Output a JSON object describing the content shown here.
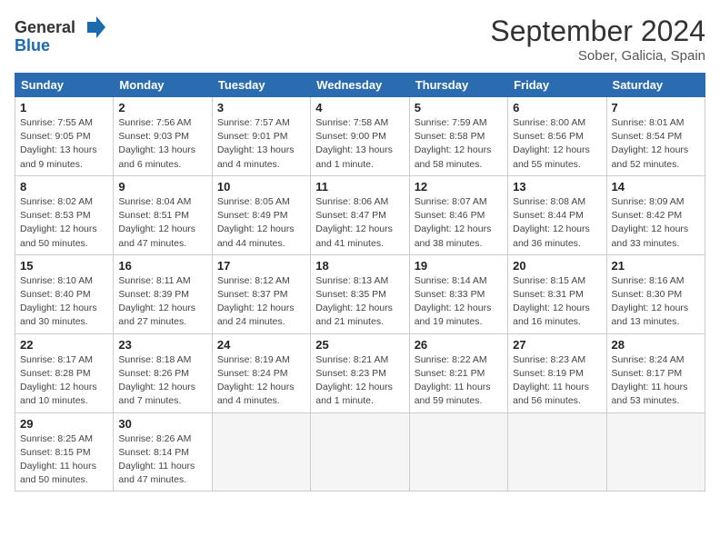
{
  "header": {
    "logo_general": "General",
    "logo_blue": "Blue",
    "month_title": "September 2024",
    "subtitle": "Sober, Galicia, Spain"
  },
  "days_of_week": [
    "Sunday",
    "Monday",
    "Tuesday",
    "Wednesday",
    "Thursday",
    "Friday",
    "Saturday"
  ],
  "weeks": [
    [
      {
        "day": "1",
        "sunrise": "7:55 AM",
        "sunset": "9:05 PM",
        "daylight": "13 hours and 9 minutes."
      },
      {
        "day": "2",
        "sunrise": "7:56 AM",
        "sunset": "9:03 PM",
        "daylight": "13 hours and 6 minutes."
      },
      {
        "day": "3",
        "sunrise": "7:57 AM",
        "sunset": "9:01 PM",
        "daylight": "13 hours and 4 minutes."
      },
      {
        "day": "4",
        "sunrise": "7:58 AM",
        "sunset": "9:00 PM",
        "daylight": "13 hours and 1 minute."
      },
      {
        "day": "5",
        "sunrise": "7:59 AM",
        "sunset": "8:58 PM",
        "daylight": "12 hours and 58 minutes."
      },
      {
        "day": "6",
        "sunrise": "8:00 AM",
        "sunset": "8:56 PM",
        "daylight": "12 hours and 55 minutes."
      },
      {
        "day": "7",
        "sunrise": "8:01 AM",
        "sunset": "8:54 PM",
        "daylight": "12 hours and 52 minutes."
      }
    ],
    [
      {
        "day": "8",
        "sunrise": "8:02 AM",
        "sunset": "8:53 PM",
        "daylight": "12 hours and 50 minutes."
      },
      {
        "day": "9",
        "sunrise": "8:04 AM",
        "sunset": "8:51 PM",
        "daylight": "12 hours and 47 minutes."
      },
      {
        "day": "10",
        "sunrise": "8:05 AM",
        "sunset": "8:49 PM",
        "daylight": "12 hours and 44 minutes."
      },
      {
        "day": "11",
        "sunrise": "8:06 AM",
        "sunset": "8:47 PM",
        "daylight": "12 hours and 41 minutes."
      },
      {
        "day": "12",
        "sunrise": "8:07 AM",
        "sunset": "8:46 PM",
        "daylight": "12 hours and 38 minutes."
      },
      {
        "day": "13",
        "sunrise": "8:08 AM",
        "sunset": "8:44 PM",
        "daylight": "12 hours and 36 minutes."
      },
      {
        "day": "14",
        "sunrise": "8:09 AM",
        "sunset": "8:42 PM",
        "daylight": "12 hours and 33 minutes."
      }
    ],
    [
      {
        "day": "15",
        "sunrise": "8:10 AM",
        "sunset": "8:40 PM",
        "daylight": "12 hours and 30 minutes."
      },
      {
        "day": "16",
        "sunrise": "8:11 AM",
        "sunset": "8:39 PM",
        "daylight": "12 hours and 27 minutes."
      },
      {
        "day": "17",
        "sunrise": "8:12 AM",
        "sunset": "8:37 PM",
        "daylight": "12 hours and 24 minutes."
      },
      {
        "day": "18",
        "sunrise": "8:13 AM",
        "sunset": "8:35 PM",
        "daylight": "12 hours and 21 minutes."
      },
      {
        "day": "19",
        "sunrise": "8:14 AM",
        "sunset": "8:33 PM",
        "daylight": "12 hours and 19 minutes."
      },
      {
        "day": "20",
        "sunrise": "8:15 AM",
        "sunset": "8:31 PM",
        "daylight": "12 hours and 16 minutes."
      },
      {
        "day": "21",
        "sunrise": "8:16 AM",
        "sunset": "8:30 PM",
        "daylight": "12 hours and 13 minutes."
      }
    ],
    [
      {
        "day": "22",
        "sunrise": "8:17 AM",
        "sunset": "8:28 PM",
        "daylight": "12 hours and 10 minutes."
      },
      {
        "day": "23",
        "sunrise": "8:18 AM",
        "sunset": "8:26 PM",
        "daylight": "12 hours and 7 minutes."
      },
      {
        "day": "24",
        "sunrise": "8:19 AM",
        "sunset": "8:24 PM",
        "daylight": "12 hours and 4 minutes."
      },
      {
        "day": "25",
        "sunrise": "8:21 AM",
        "sunset": "8:23 PM",
        "daylight": "12 hours and 1 minute."
      },
      {
        "day": "26",
        "sunrise": "8:22 AM",
        "sunset": "8:21 PM",
        "daylight": "11 hours and 59 minutes."
      },
      {
        "day": "27",
        "sunrise": "8:23 AM",
        "sunset": "8:19 PM",
        "daylight": "11 hours and 56 minutes."
      },
      {
        "day": "28",
        "sunrise": "8:24 AM",
        "sunset": "8:17 PM",
        "daylight": "11 hours and 53 minutes."
      }
    ],
    [
      {
        "day": "29",
        "sunrise": "8:25 AM",
        "sunset": "8:15 PM",
        "daylight": "11 hours and 50 minutes."
      },
      {
        "day": "30",
        "sunrise": "8:26 AM",
        "sunset": "8:14 PM",
        "daylight": "11 hours and 47 minutes."
      },
      null,
      null,
      null,
      null,
      null
    ]
  ]
}
